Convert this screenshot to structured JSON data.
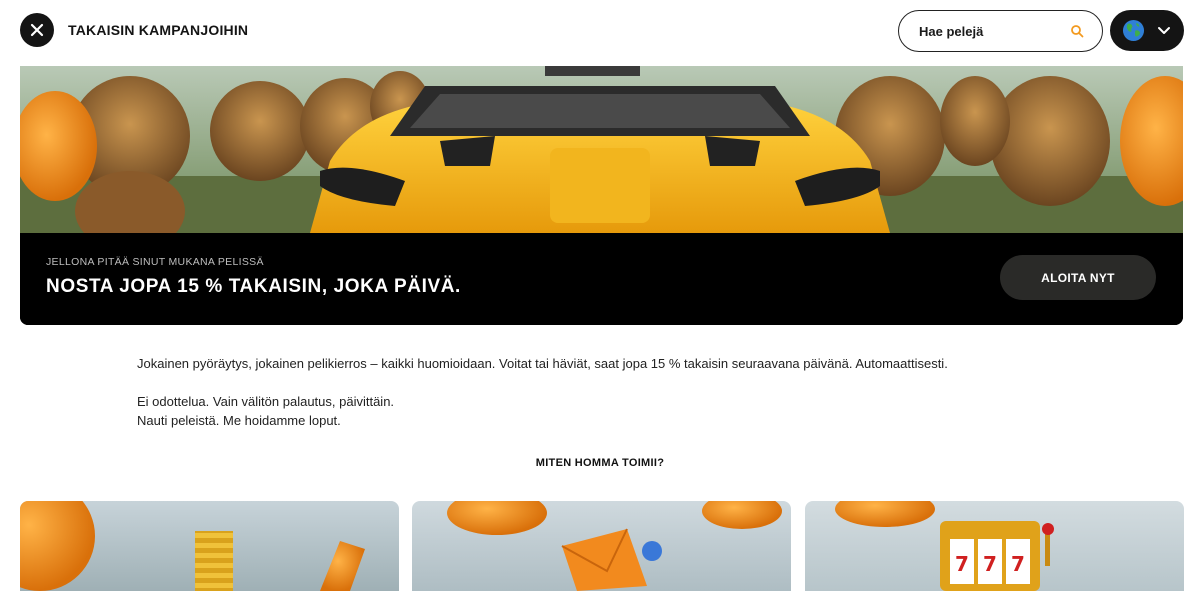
{
  "header": {
    "back_label": "TAKAISIN KAMPANJOIHIN",
    "search_placeholder": "Hae pelejä"
  },
  "hero": {
    "kicker": "JELLONA PITÄÄ SINUT MUKANA PELISSÄ",
    "title": "NOSTA JOPA 15 % TAKAISIN, JOKA PÄIVÄ.",
    "cta_label": "ALOITA NYT"
  },
  "body": {
    "paragraph_1": "Jokainen pyöräytys, jokainen pelikierros – kaikki huomioidaan. Voitat tai häviät, saat jopa 15 % takaisin seuraavana päivänä. Automaattisesti.",
    "paragraph_2_line_1": "Ei odottelua. Vain välitön palautus, päivittäin.",
    "paragraph_2_line_2": "Nauti peleistä. Me hoidamme loput."
  },
  "how_it_works": {
    "title": "MITEN HOMMA TOIMII?"
  },
  "colors": {
    "dark": "#141414",
    "accent_orange": "#f39a1f",
    "hero_bar": "#000000"
  }
}
